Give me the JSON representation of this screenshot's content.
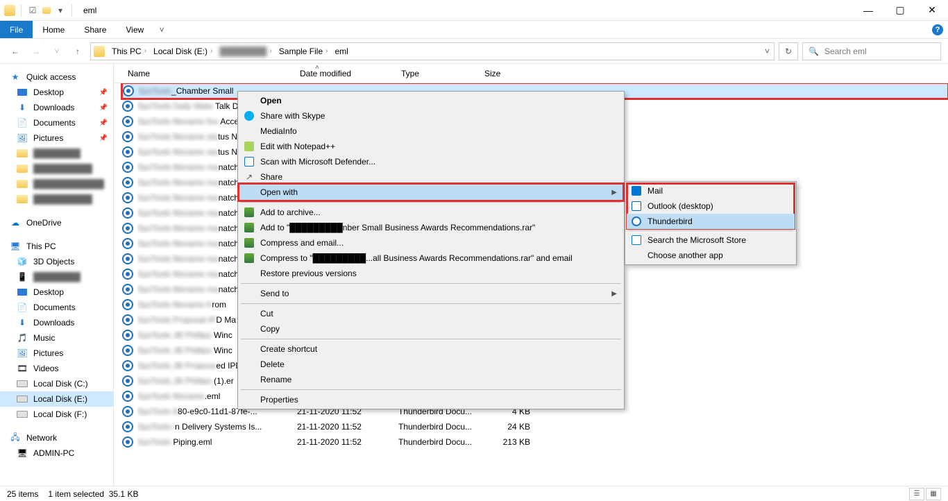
{
  "window": {
    "title": "eml"
  },
  "ribbon": {
    "file": "File",
    "home": "Home",
    "share": "Share",
    "view": "View"
  },
  "breadcrumbs": [
    "This PC",
    "Local Disk (E:)",
    "████████",
    "Sample File",
    "eml"
  ],
  "addr": {
    "refresh": "↻",
    "dropdown": "˅"
  },
  "search": {
    "placeholder": "Search eml"
  },
  "columns": {
    "name": "Name",
    "date": "Date modified",
    "type": "Type",
    "size": "Size"
  },
  "sidebar": {
    "quick": "Quick access",
    "desktop": "Desktop",
    "downloads": "Downloads",
    "documents": "Documents",
    "pictures": "Pictures",
    "hidden": [
      "████████",
      "██████████",
      "████████████",
      "██████████"
    ],
    "onedrive": "OneDrive",
    "thispc": "This PC",
    "pc_items": [
      "3D Objects",
      "████████",
      "Desktop",
      "Documents",
      "Downloads",
      "Music",
      "Pictures",
      "Videos",
      "Local Disk (C:)",
      "Local Disk (E:)",
      "Local Disk (F:)"
    ],
    "network": "Network",
    "adminpc": "ADMIN-PC"
  },
  "files": {
    "selected": "_Chamber Small",
    "rows": [
      {
        "suffix": " Talk D"
      },
      {
        "suffix": " Accep"
      },
      {
        "suffix": "tus N"
      },
      {
        "suffix": "tus N"
      },
      {
        "suffix": "natch"
      },
      {
        "suffix": "natch"
      },
      {
        "suffix": "natch"
      },
      {
        "suffix": "natch"
      },
      {
        "suffix": "natch"
      },
      {
        "suffix": "natch"
      },
      {
        "suffix": "natch"
      },
      {
        "suffix": "natch"
      },
      {
        "suffix": "natch"
      },
      {
        "suffix": "rom"
      },
      {
        "suffix": "D Ma"
      },
      {
        "suffix": " Winc"
      },
      {
        "suffix": " Winc"
      },
      {
        "suffix": "ed IPD"
      },
      {
        "suffix": " (1).er"
      },
      {
        "suffix": ".eml"
      }
    ],
    "visible": [
      {
        "name": "80-e9c0-11d1-87fe-...",
        "date": "21-11-2020 11:52",
        "type": "Thunderbird Docu...",
        "size": "4 KB"
      },
      {
        "name": "n Delivery Systems Is...",
        "date": "21-11-2020 11:52",
        "type": "Thunderbird Docu...",
        "size": "24 KB"
      },
      {
        "name": "Piping.eml",
        "date": "21-11-2020 11:52",
        "type": "Thunderbird Docu...",
        "size": "213 KB"
      }
    ]
  },
  "context": {
    "open": "Open",
    "skype": "Share with Skype",
    "mediainfo": "MediaInfo",
    "notepadpp": "Edit with Notepad++",
    "defender": "Scan with Microsoft Defender...",
    "share": "Share",
    "openwith": "Open with",
    "addarchive": "Add to archive...",
    "addto": "Add to \"█████████nber Small Business Awards Recommendations.rar\"",
    "compressemail": "Compress and email...",
    "compressto": "Compress to \"█████████...all Business Awards Recommendations.rar\" and email",
    "restore": "Restore previous versions",
    "sendto": "Send to",
    "cut": "Cut",
    "copy": "Copy",
    "shortcut": "Create shortcut",
    "delete": "Delete",
    "rename": "Rename",
    "properties": "Properties"
  },
  "submenu": {
    "mail": "Mail",
    "outlook": "Outlook (desktop)",
    "thunderbird": "Thunderbird",
    "store": "Search the Microsoft Store",
    "another": "Choose another app"
  },
  "status": {
    "items": "25 items",
    "selected": "1 item selected",
    "size": "35.1 KB"
  }
}
